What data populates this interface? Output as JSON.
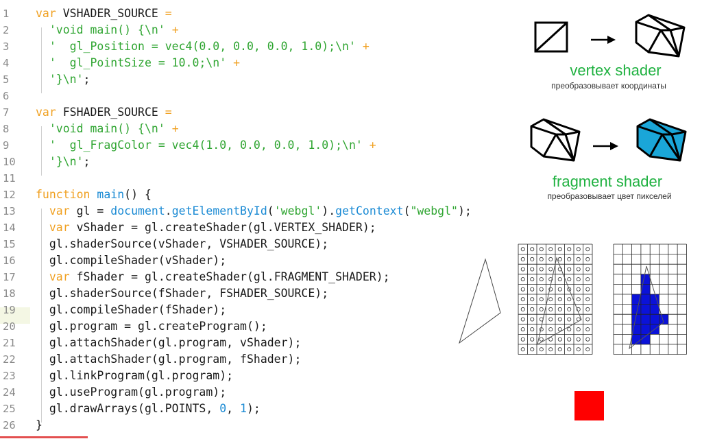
{
  "editor": {
    "lines": [
      {
        "n": "1",
        "tokens": [
          [
            "kw",
            "var "
          ],
          [
            "t",
            "VSHADER_SOURCE "
          ],
          [
            "plus",
            "="
          ]
        ]
      },
      {
        "n": "2",
        "tokens": [
          [
            "t",
            "  "
          ],
          [
            "str",
            "'void main() {\\n'"
          ],
          [
            "plus",
            " +"
          ]
        ]
      },
      {
        "n": "3",
        "tokens": [
          [
            "t",
            "  "
          ],
          [
            "str",
            "'  gl_Position = vec4(0.0, 0.0, 0.0, 1.0);\\n'"
          ],
          [
            "plus",
            " +"
          ]
        ]
      },
      {
        "n": "4",
        "tokens": [
          [
            "t",
            "  "
          ],
          [
            "str",
            "'  gl_PointSize = 10.0;\\n'"
          ],
          [
            "plus",
            " +"
          ]
        ]
      },
      {
        "n": "5",
        "tokens": [
          [
            "t",
            "  "
          ],
          [
            "str",
            "'}\\n'"
          ],
          [
            "t",
            ";"
          ]
        ]
      },
      {
        "n": "6",
        "tokens": []
      },
      {
        "n": "7",
        "tokens": [
          [
            "kw",
            "var "
          ],
          [
            "t",
            "FSHADER_SOURCE "
          ],
          [
            "plus",
            "="
          ]
        ]
      },
      {
        "n": "8",
        "tokens": [
          [
            "t",
            "  "
          ],
          [
            "str",
            "'void main() {\\n'"
          ],
          [
            "plus",
            " +"
          ]
        ]
      },
      {
        "n": "9",
        "tokens": [
          [
            "t",
            "  "
          ],
          [
            "str",
            "'  gl_FragColor = vec4(1.0, 0.0, 0.0, 1.0);\\n'"
          ],
          [
            "plus",
            " +"
          ]
        ]
      },
      {
        "n": "10",
        "tokens": [
          [
            "t",
            "  "
          ],
          [
            "str",
            "'}\\n'"
          ],
          [
            "t",
            ";"
          ]
        ]
      },
      {
        "n": "11",
        "tokens": []
      },
      {
        "n": "12",
        "tokens": [
          [
            "kw",
            "function "
          ],
          [
            "fn",
            "main"
          ],
          [
            "t",
            "() {"
          ]
        ]
      },
      {
        "n": "13",
        "tokens": [
          [
            "t",
            "  "
          ],
          [
            "kw",
            "var "
          ],
          [
            "t",
            "gl = "
          ],
          [
            "fn",
            "document"
          ],
          [
            "t",
            "."
          ],
          [
            "fn",
            "getElementById"
          ],
          [
            "t",
            "("
          ],
          [
            "str",
            "'webgl'"
          ],
          [
            "t",
            ")."
          ],
          [
            "fn",
            "getContext"
          ],
          [
            "t",
            "("
          ],
          [
            "str",
            "\"webgl\""
          ],
          [
            "t",
            ");"
          ]
        ]
      },
      {
        "n": "14",
        "tokens": [
          [
            "t",
            "  "
          ],
          [
            "kw",
            "var "
          ],
          [
            "t",
            "vShader = gl.createShader(gl.VERTEX_SHADER);"
          ]
        ]
      },
      {
        "n": "15",
        "tokens": [
          [
            "t",
            "  gl.shaderSource(vShader, VSHADER_SOURCE);"
          ]
        ]
      },
      {
        "n": "16",
        "tokens": [
          [
            "t",
            "  gl.compileShader(vShader);"
          ]
        ]
      },
      {
        "n": "17",
        "tokens": [
          [
            "t",
            "  "
          ],
          [
            "kw",
            "var "
          ],
          [
            "t",
            "fShader = gl.createShader(gl.FRAGMENT_SHADER);"
          ]
        ]
      },
      {
        "n": "18",
        "tokens": [
          [
            "t",
            "  gl.shaderSource(fShader, FSHADER_SOURCE);"
          ]
        ]
      },
      {
        "n": "19",
        "tokens": [
          [
            "t",
            "  gl.compileShader(fShader);"
          ]
        ]
      },
      {
        "n": "20",
        "tokens": [
          [
            "t",
            "  gl.program = gl.createProgram();"
          ]
        ]
      },
      {
        "n": "21",
        "tokens": [
          [
            "t",
            "  gl.attachShader(gl.program, vShader);"
          ]
        ]
      },
      {
        "n": "22",
        "tokens": [
          [
            "t",
            "  gl.attachShader(gl.program, fShader);"
          ]
        ]
      },
      {
        "n": "23",
        "tokens": [
          [
            "t",
            "  gl.linkProgram(gl.program);"
          ]
        ]
      },
      {
        "n": "24",
        "tokens": [
          [
            "t",
            "  gl.useProgram(gl.program);"
          ]
        ]
      },
      {
        "n": "25",
        "tokens": [
          [
            "t",
            "  gl.drawArrays(gl.POINTS, "
          ],
          [
            "num",
            "0"
          ],
          [
            "t",
            ", "
          ],
          [
            "num",
            "1"
          ],
          [
            "t",
            ");"
          ]
        ]
      },
      {
        "n": "26",
        "tokens": [
          [
            "t",
            "}"
          ]
        ]
      }
    ]
  },
  "diagram": {
    "vertex_title": "vertex shader",
    "vertex_subtitle": "преобразовывает координаты",
    "fragment_title": "fragment shader",
    "fragment_subtitle": "преобразовывает цвет пикселей",
    "colors": {
      "accent_green": "#1fb140",
      "fill_cyan": "#1aa6d8",
      "raster_blue": "#0b12d8",
      "point_red": "#ff0000"
    }
  }
}
